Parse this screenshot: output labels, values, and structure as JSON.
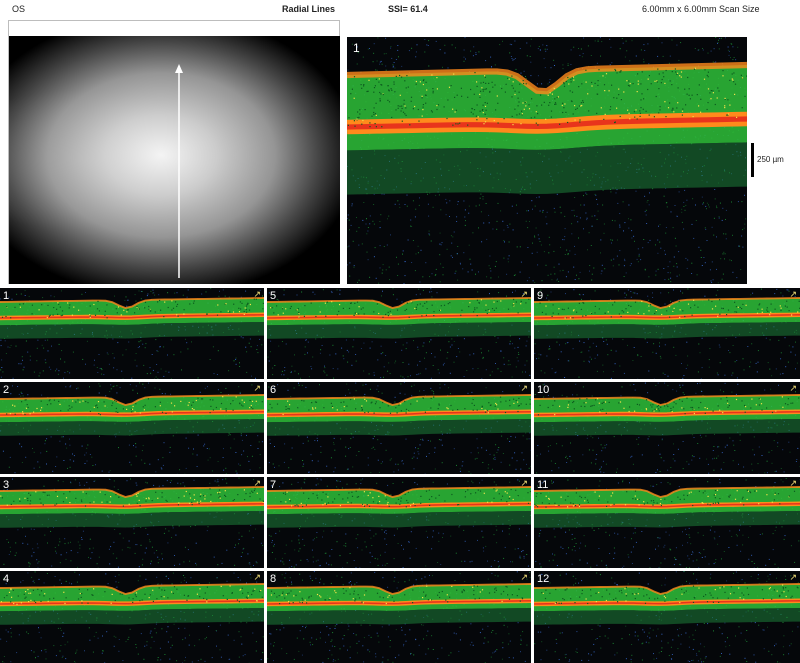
{
  "header": {
    "eye": "OS",
    "scan_pattern": "Radial Lines",
    "ssi": "SSI= 61.4",
    "scan_size": "6.00mm x 6.00mm Scan Size"
  },
  "main_scan": {
    "label": "1"
  },
  "scale": {
    "label": "250 µm"
  },
  "thumbnails": [
    {
      "label": "1"
    },
    {
      "label": "5"
    },
    {
      "label": "9"
    },
    {
      "label": "2"
    },
    {
      "label": "6"
    },
    {
      "label": "10"
    },
    {
      "label": "3"
    },
    {
      "label": "7"
    },
    {
      "label": "11"
    },
    {
      "label": "4"
    },
    {
      "label": "8"
    },
    {
      "label": "12"
    }
  ],
  "colors": {
    "background": "#ffffff",
    "scan_background": "#05070a",
    "retina_green": "#2fbf3a",
    "rpe_orange": "#ff8a1c",
    "rpe_red": "#e8341c",
    "noise_blue": "#3a6fd8",
    "scan_line": "#ffffff"
  },
  "icons": {
    "scan_direction": "arrow-icon"
  }
}
